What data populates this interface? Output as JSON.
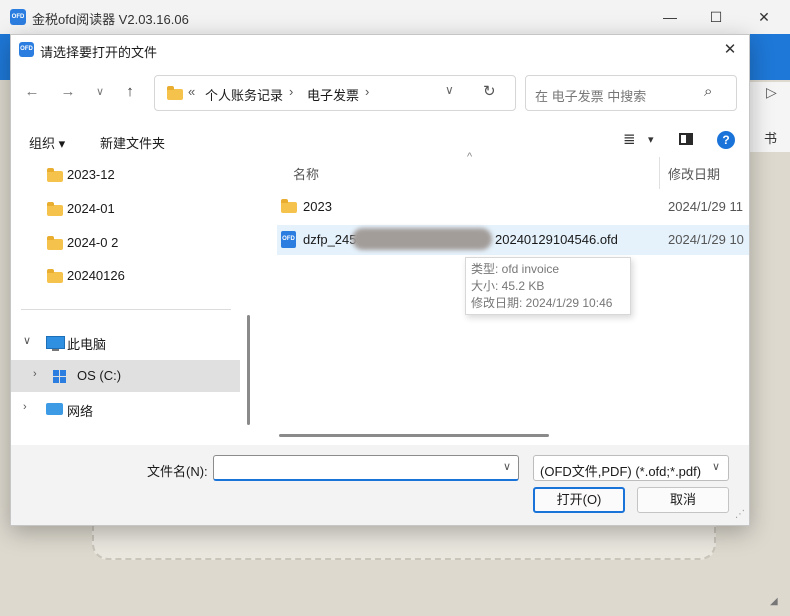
{
  "app": {
    "title": "金税ofd阅读器 V2.03.16.06",
    "logo_text": "OFD",
    "minimize": "—",
    "maximize": "☐",
    "close": "✕",
    "right_glyph": "▷",
    "right_glyph2": "书",
    "corner_glyph": "◢"
  },
  "dialog": {
    "title": "请选择要打开的文件",
    "icon_text": "OFD",
    "close": "✕",
    "nav": {
      "back": "←",
      "forward": "→",
      "recent": "∨",
      "up": "↑"
    },
    "address": {
      "overflow": "«",
      "parts": [
        "个人账务记录",
        "电子发票"
      ],
      "sep": "›",
      "dropdown": "∨",
      "refresh": "↻"
    },
    "search": {
      "placeholder": "在 电子发票 中搜索",
      "icon": "⌕"
    },
    "toolbar": {
      "organize": "组织 ▾",
      "new_folder": "新建文件夹",
      "view": "≣",
      "view_dd": "▾",
      "help": "?"
    },
    "nav_pane": {
      "folders": [
        "2023-12",
        "2024-01",
        "2024-0 2",
        "20240126"
      ],
      "this_pc": "此电脑",
      "os_drive": "OS (C:)",
      "network": "网络",
      "chev_open": "∨",
      "chev_closed": "›"
    },
    "list": {
      "sort_arrow": "^",
      "col_name": "名称",
      "col_modified": "修改日期",
      "rows": [
        {
          "name": "2023",
          "modified": "2024/1/29 11",
          "kind": "folder"
        },
        {
          "name_prefix": "dzfp_245",
          "name_suffix": "20240129104546.ofd",
          "modified": "2024/1/29 10",
          "kind": "ofd",
          "icon_text": "OFD"
        }
      ],
      "tooltip": {
        "type": "类型: ofd invoice",
        "size": "大小: 45.2 KB",
        "modified": "修改日期: 2024/1/29 10:46"
      }
    },
    "bottom": {
      "filename_label": "文件名(N):",
      "filename_value": "",
      "filename_dd": "∨",
      "filetype": "(OFD文件,PDF) (*.ofd;*.pdf)",
      "filetype_dd": "∨",
      "open": "打开(O)",
      "cancel": "取消",
      "grip": "⋰"
    }
  }
}
